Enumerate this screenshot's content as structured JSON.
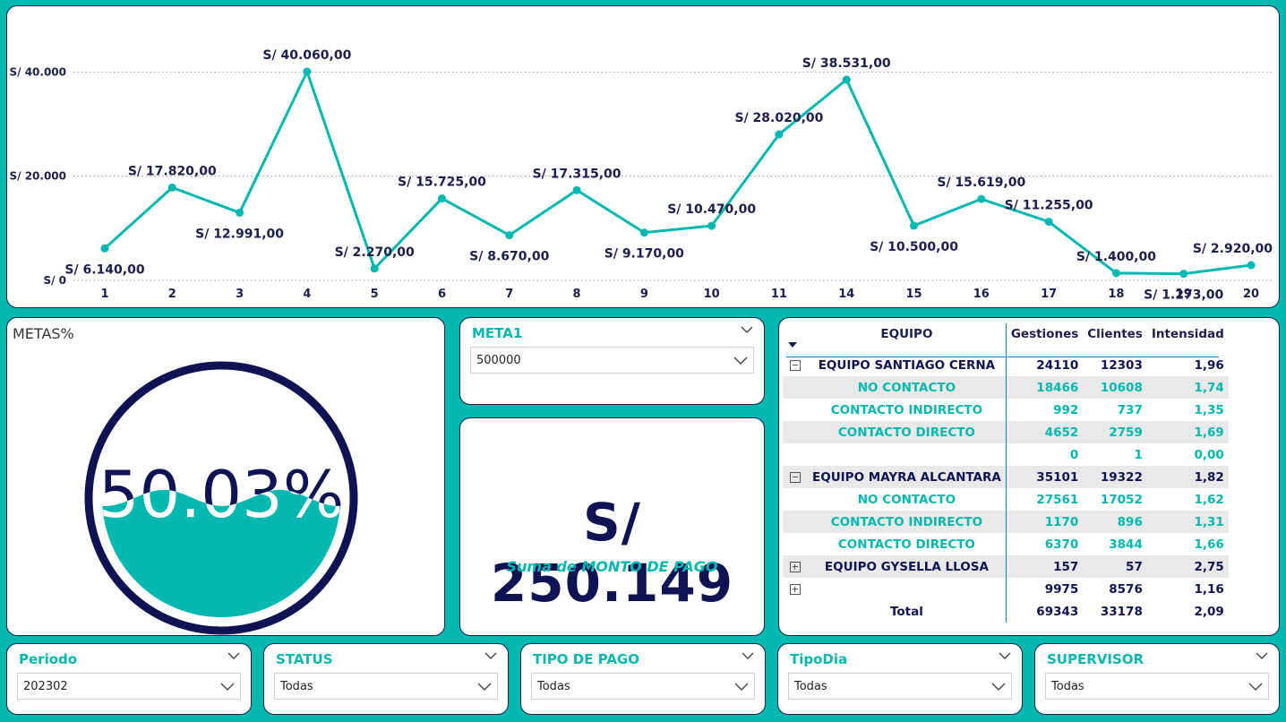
{
  "colors": {
    "accent": "#02B8B1",
    "navy": "#0d1353",
    "border": "#1b1f4d"
  },
  "chart_data": {
    "type": "line",
    "categories": [
      "1",
      "2",
      "3",
      "4",
      "5",
      "6",
      "7",
      "8",
      "9",
      "10",
      "11",
      "14",
      "15",
      "16",
      "17",
      "18",
      "19",
      "20"
    ],
    "values": [
      6140,
      17820,
      12991,
      40060,
      2270,
      15725,
      8670,
      17315,
      9170,
      10470,
      28020,
      38531,
      10500,
      15619,
      11255,
      1400,
      1273,
      2920
    ],
    "data_labels": [
      "S/ 6.140,00",
      "S/ 17.820,00",
      "S/ 12.991,00",
      "S/ 40.060,00",
      "S/ 2.270,00",
      "S/ 15.725,00",
      "S/ 8.670,00",
      "S/ 17.315,00",
      "S/ 9.170,00",
      "S/ 10.470,00",
      "S/ 28.020,00",
      "S/ 38.531,00",
      "S/ 10.500,00",
      "S/ 15.619,00",
      "S/ 11.255,00",
      "S/ 1.400,00",
      "S/ 1.273,00",
      "S/ 2.920,00"
    ],
    "label_above": [
      false,
      true,
      false,
      true,
      true,
      true,
      false,
      true,
      false,
      true,
      true,
      true,
      false,
      true,
      true,
      true,
      false,
      true
    ],
    "yticks": [
      0,
      20000,
      40000
    ],
    "ytick_labels": [
      "S/ 0",
      "S/ 20.000",
      "S/ 40.000"
    ],
    "ylim": [
      0,
      40060
    ],
    "grid": true,
    "title": "",
    "xlabel": "",
    "ylabel": ""
  },
  "gauge": {
    "title": "METAS%",
    "value_text": "50.03%",
    "fraction": 0.5003
  },
  "meta_slicer": {
    "title": "META1",
    "value": "500000"
  },
  "kpi": {
    "value": "S/ 250.149",
    "label": "Suma de MONTO DE PAGO"
  },
  "matrix": {
    "headers": {
      "team": "EQUIPO",
      "gestiones": "Gestiones",
      "clientes": "Clientes",
      "intensidad": "Intensidad"
    },
    "rows": [
      {
        "level": 1,
        "expand": "minus",
        "team": "EQUIPO SANTIAGO CERNA",
        "g": "24110",
        "c": "12303",
        "i": "1,96"
      },
      {
        "level": 2,
        "team": "NO CONTACTO",
        "g": "18466",
        "c": "10608",
        "i": "1,74"
      },
      {
        "level": 2,
        "team": "CONTACTO INDIRECTO",
        "g": "992",
        "c": "737",
        "i": "1,35"
      },
      {
        "level": 2,
        "team": "CONTACTO DIRECTO",
        "g": "4652",
        "c": "2759",
        "i": "1,69"
      },
      {
        "level": 2,
        "team": "",
        "g": "0",
        "c": "1",
        "i": "0,00"
      },
      {
        "level": 1,
        "expand": "minus",
        "team": "EQUIPO MAYRA ALCANTARA",
        "g": "35101",
        "c": "19322",
        "i": "1,82"
      },
      {
        "level": 2,
        "team": "NO CONTACTO",
        "g": "27561",
        "c": "17052",
        "i": "1,62"
      },
      {
        "level": 2,
        "team": "CONTACTO INDIRECTO",
        "g": "1170",
        "c": "896",
        "i": "1,31"
      },
      {
        "level": 2,
        "team": "CONTACTO DIRECTO",
        "g": "6370",
        "c": "3844",
        "i": "1,66"
      },
      {
        "level": 1,
        "expand": "plus",
        "team": "EQUIPO GYSELLA LLOSA",
        "g": "157",
        "c": "57",
        "i": "2,75"
      },
      {
        "level": 1,
        "expand": "plus",
        "team": "",
        "g": "9975",
        "c": "8576",
        "i": "1,16"
      }
    ],
    "total": {
      "team": "Total",
      "g": "69343",
      "c": "33178",
      "i": "2,09"
    }
  },
  "slicers": [
    {
      "title": "Periodo",
      "value": "202302"
    },
    {
      "title": "STATUS",
      "value": "Todas"
    },
    {
      "title": "TIPO DE PAGO",
      "value": "Todas"
    },
    {
      "title": "TipoDia",
      "value": "Todas"
    },
    {
      "title": "SUPERVISOR",
      "value": "Todas"
    }
  ]
}
